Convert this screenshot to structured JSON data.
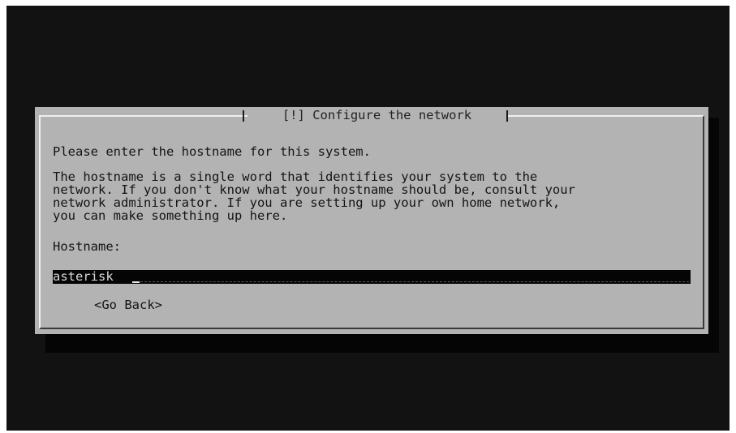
{
  "dialog": {
    "title": "[!] Configure the network",
    "prompt": "Please enter the hostname for this system.",
    "description_lines": [
      "The hostname is a single word that identifies your system to the",
      "network. If you don't know what your hostname should be, consult your",
      "network administrator. If you are setting up your own home network,",
      "you can make something up here."
    ],
    "field_label": "Hostname:",
    "field_value": "asterisk",
    "go_back_label": "<Go Back>"
  },
  "colors": {
    "screen_background": "#121212",
    "dialog_background": "#b3b3b3",
    "field_background": "#050505",
    "text": "#141414"
  }
}
